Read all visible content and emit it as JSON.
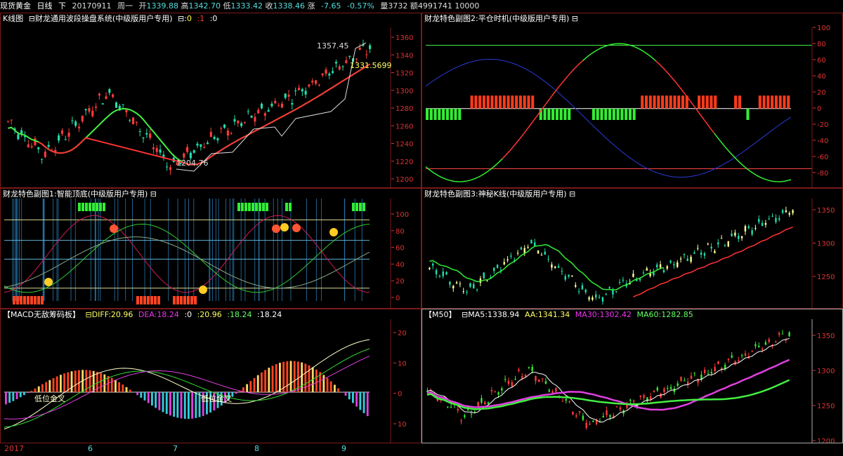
{
  "topbar": {
    "symbol": "现货黄金",
    "period": "日线",
    "direction": "下",
    "date": "20170911",
    "weekday": "周一",
    "open_label": "开",
    "open": "1339.88",
    "high_label": "高",
    "high": "1342.70",
    "low_label": "低",
    "low": "1333.42",
    "close_label": "收",
    "close": "1338.46",
    "change_label": "涨",
    "change": "-7.65",
    "change_pct": "-0.57%",
    "volume_label": "量",
    "volume": "3732",
    "amount_label": "额",
    "amount": "4991741",
    "extra": "10000"
  },
  "panels": {
    "kline": {
      "title": "K线图",
      "indicator": "⊟财龙通用波段操盘系统(中级版用户专用)",
      "param_prefix": "⊟:",
      "p0": "0",
      "p1": ":1",
      "p2": ":0",
      "peak_label": "1357.45",
      "last_label": "1331.5699",
      "low_label": "1204.76",
      "axis": [
        "1360",
        "1340",
        "1320",
        "1300",
        "1280",
        "1260",
        "1240",
        "1220",
        "1200"
      ]
    },
    "sub1": {
      "title": "财龙特色副图1:智能顶底(中级版用户专用) ⊟",
      "axis": [
        "100",
        "80",
        "60",
        "40",
        "20",
        "0"
      ]
    },
    "sub2": {
      "title": "财龙特色副图2:平仓时机(中级版用户专用) ⊟",
      "axis": [
        "100",
        "80",
        "60",
        "40",
        "20",
        "0",
        "-20",
        "-40",
        "-60",
        "-80"
      ]
    },
    "sub3": {
      "title": "财龙特色副图3:神秘K线(中级版用户专用) ⊟",
      "axis": [
        "1350",
        "1300",
        "1250"
      ]
    },
    "macd": {
      "title": "【MACD无敌筹码板】",
      "diff_label": "⊟DIFF:20.96",
      "dea_label": "DEA:18.24",
      "v0": ":0",
      "v1": ":20.96",
      "v2": ":18.24",
      "v3": ":18.24",
      "cross1": "低位金叉",
      "cross2": "低位金叉",
      "axis": [
        "20",
        "10",
        "0",
        "10"
      ]
    },
    "ma": {
      "title": "【M50】",
      "ma5": "⊟MA5:1338.94",
      "aa": "AA:1341.34",
      "ma30": "MA30:1302.42",
      "ma60": "MA60:1282.85",
      "axis": [
        "1350",
        "1300",
        "1250",
        "1200"
      ]
    }
  },
  "xaxis": {
    "year": "2017",
    "months": [
      "6",
      "7",
      "8",
      "9"
    ]
  },
  "colors": {
    "up": "#ff3333",
    "down": "#22ddaa",
    "axis_text": "#dd3333",
    "border": "#7a1a1a",
    "highlight_yellow": "#ffff66"
  }
}
